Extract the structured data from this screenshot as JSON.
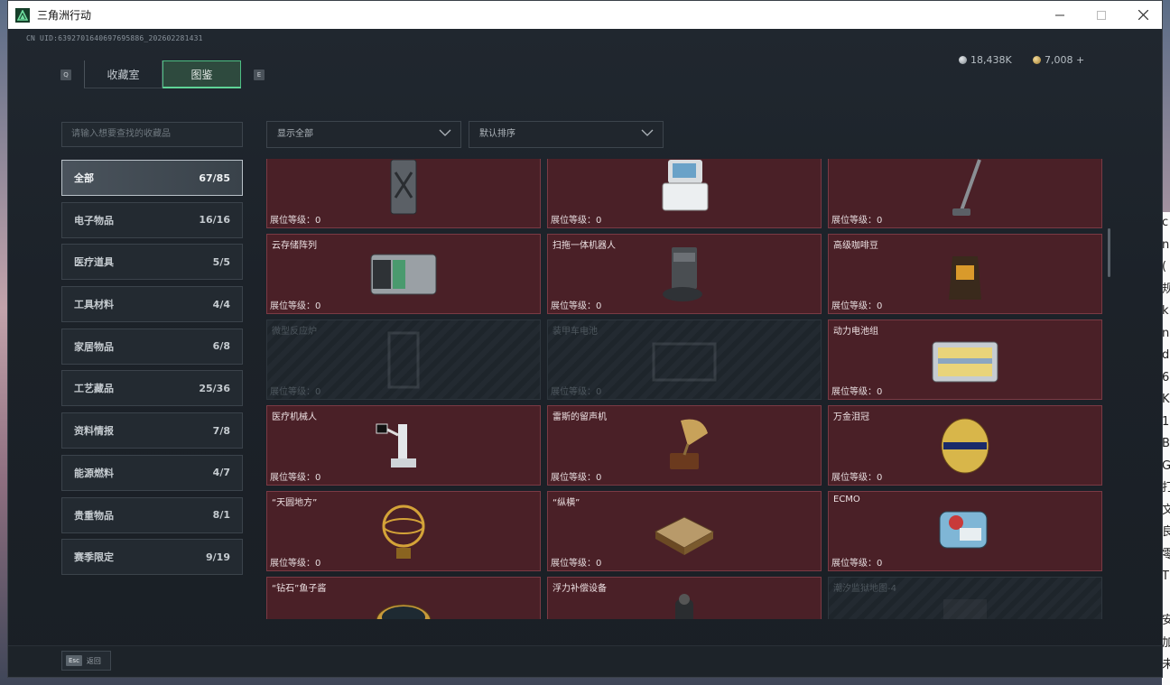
{
  "window": {
    "title": "三角洲行动"
  },
  "uid": "CN UID:6392701640697695886_202602281431",
  "tabs": {
    "hint_left": "Q",
    "hint_right": "E",
    "items": [
      {
        "label": "收藏室"
      },
      {
        "label": "图鉴"
      }
    ],
    "active": 1
  },
  "currency": {
    "silver": "18,438K",
    "gold": "7,008 +"
  },
  "search": {
    "placeholder": "请输入想要查找的收藏品"
  },
  "filters": {
    "show": "显示全部",
    "sort": "默认排序"
  },
  "categories": [
    {
      "name": "全部",
      "count": "67/85"
    },
    {
      "name": "电子物品",
      "count": "16/16"
    },
    {
      "name": "医疗道具",
      "count": "5/5"
    },
    {
      "name": "工具材料",
      "count": "4/4"
    },
    {
      "name": "家居物品",
      "count": "6/8"
    },
    {
      "name": "工艺藏品",
      "count": "25/36"
    },
    {
      "name": "资料情报",
      "count": "7/8"
    },
    {
      "name": "能源燃料",
      "count": "4/7"
    },
    {
      "name": "贵重物品",
      "count": "8/1"
    },
    {
      "name": "赛季限定",
      "count": "9/19"
    }
  ],
  "level_label": "展位等级：0",
  "items": [
    {
      "name": "",
      "locked": false,
      "icon": "jerrycan-icon"
    },
    {
      "name": "",
      "locked": false,
      "icon": "server-monitor-icon"
    },
    {
      "name": "",
      "locked": false,
      "icon": "vacuum-icon"
    },
    {
      "name": "云存储阵列",
      "locked": false,
      "icon": "storage-array-icon"
    },
    {
      "name": "扫拖一体机器人",
      "locked": false,
      "icon": "robot-vacuum-icon"
    },
    {
      "name": "高级咖啡豆",
      "locked": false,
      "icon": "coffee-bag-icon"
    },
    {
      "name": "微型反应炉",
      "locked": true,
      "icon": "reactor-icon"
    },
    {
      "name": "装甲车电池",
      "locked": true,
      "icon": "battery-icon"
    },
    {
      "name": "动力电池组",
      "locked": false,
      "icon": "battery-pack-icon"
    },
    {
      "name": "医疗机械人",
      "locked": false,
      "icon": "medical-robot-icon"
    },
    {
      "name": "雷斯的留声机",
      "locked": false,
      "icon": "gramophone-icon"
    },
    {
      "name": "万金泪冠",
      "locked": false,
      "icon": "jewel-egg-icon"
    },
    {
      "name": "“天圆地方”",
      "locked": false,
      "icon": "armillary-icon"
    },
    {
      "name": "“纵横”",
      "locked": false,
      "icon": "chessboard-icon"
    },
    {
      "name": "ECMO",
      "locked": false,
      "icon": "ecmo-icon"
    },
    {
      "name": "“钻石”鱼子酱",
      "locked": false,
      "icon": "caviar-icon"
    },
    {
      "name": "浮力补偿设备",
      "locked": false,
      "icon": "bcd-icon"
    },
    {
      "name": "潮汐监狱地图-4",
      "locked": true,
      "icon": "map-icon"
    }
  ],
  "footer": {
    "key": "Esc",
    "label": "返回"
  },
  "colors": {
    "accent": "#4dbd83",
    "card_bg": "#4a2027",
    "card_border": "#7a3a44"
  }
}
